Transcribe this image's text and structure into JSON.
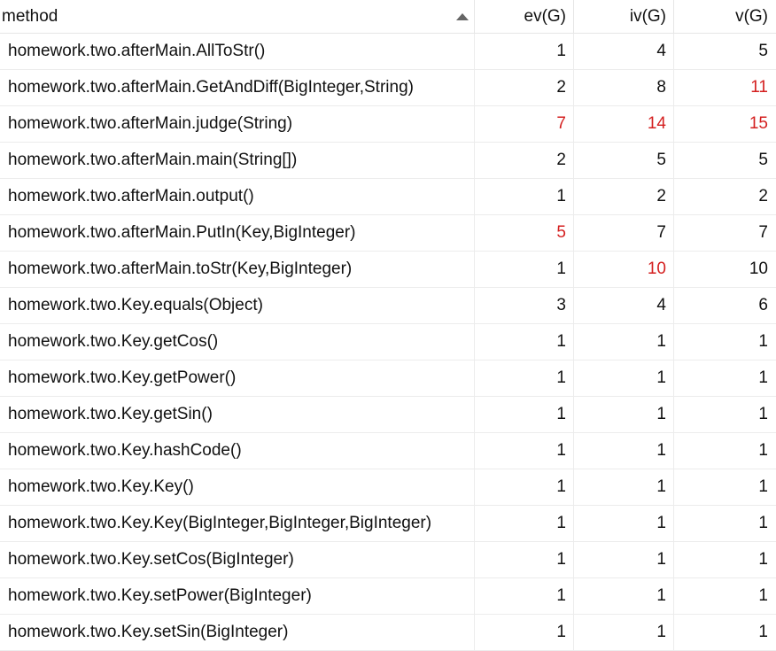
{
  "header": {
    "method": "method",
    "ev": "ev(G)",
    "iv": "iv(G)",
    "v": "v(G)",
    "sort_icon": "sort-ascending-triangle-icon"
  },
  "colors": {
    "highlight": "#d41f1f",
    "normal": "#111111"
  },
  "rows": [
    {
      "method": "homework.two.afterMain.AllToStr()",
      "ev": "1",
      "iv": "4",
      "v": "5",
      "ev_red": false,
      "iv_red": false,
      "v_red": false
    },
    {
      "method": "homework.two.afterMain.GetAndDiff(BigInteger,String)",
      "ev": "2",
      "iv": "8",
      "v": "11",
      "ev_red": false,
      "iv_red": false,
      "v_red": true
    },
    {
      "method": "homework.two.afterMain.judge(String)",
      "ev": "7",
      "iv": "14",
      "v": "15",
      "ev_red": true,
      "iv_red": true,
      "v_red": true
    },
    {
      "method": "homework.two.afterMain.main(String[])",
      "ev": "2",
      "iv": "5",
      "v": "5",
      "ev_red": false,
      "iv_red": false,
      "v_red": false
    },
    {
      "method": "homework.two.afterMain.output()",
      "ev": "1",
      "iv": "2",
      "v": "2",
      "ev_red": false,
      "iv_red": false,
      "v_red": false
    },
    {
      "method": "homework.two.afterMain.PutIn(Key,BigInteger)",
      "ev": "5",
      "iv": "7",
      "v": "7",
      "ev_red": true,
      "iv_red": false,
      "v_red": false
    },
    {
      "method": "homework.two.afterMain.toStr(Key,BigInteger)",
      "ev": "1",
      "iv": "10",
      "v": "10",
      "ev_red": false,
      "iv_red": true,
      "v_red": false
    },
    {
      "method": "homework.two.Key.equals(Object)",
      "ev": "3",
      "iv": "4",
      "v": "6",
      "ev_red": false,
      "iv_red": false,
      "v_red": false
    },
    {
      "method": "homework.two.Key.getCos()",
      "ev": "1",
      "iv": "1",
      "v": "1",
      "ev_red": false,
      "iv_red": false,
      "v_red": false
    },
    {
      "method": "homework.two.Key.getPower()",
      "ev": "1",
      "iv": "1",
      "v": "1",
      "ev_red": false,
      "iv_red": false,
      "v_red": false
    },
    {
      "method": "homework.two.Key.getSin()",
      "ev": "1",
      "iv": "1",
      "v": "1",
      "ev_red": false,
      "iv_red": false,
      "v_red": false
    },
    {
      "method": "homework.two.Key.hashCode()",
      "ev": "1",
      "iv": "1",
      "v": "1",
      "ev_red": false,
      "iv_red": false,
      "v_red": false
    },
    {
      "method": "homework.two.Key.Key()",
      "ev": "1",
      "iv": "1",
      "v": "1",
      "ev_red": false,
      "iv_red": false,
      "v_red": false
    },
    {
      "method": "homework.two.Key.Key(BigInteger,BigInteger,BigInteger)",
      "ev": "1",
      "iv": "1",
      "v": "1",
      "ev_red": false,
      "iv_red": false,
      "v_red": false
    },
    {
      "method": "homework.two.Key.setCos(BigInteger)",
      "ev": "1",
      "iv": "1",
      "v": "1",
      "ev_red": false,
      "iv_red": false,
      "v_red": false
    },
    {
      "method": "homework.two.Key.setPower(BigInteger)",
      "ev": "1",
      "iv": "1",
      "v": "1",
      "ev_red": false,
      "iv_red": false,
      "v_red": false
    },
    {
      "method": "homework.two.Key.setSin(BigInteger)",
      "ev": "1",
      "iv": "1",
      "v": "1",
      "ev_red": false,
      "iv_red": false,
      "v_red": false
    }
  ]
}
